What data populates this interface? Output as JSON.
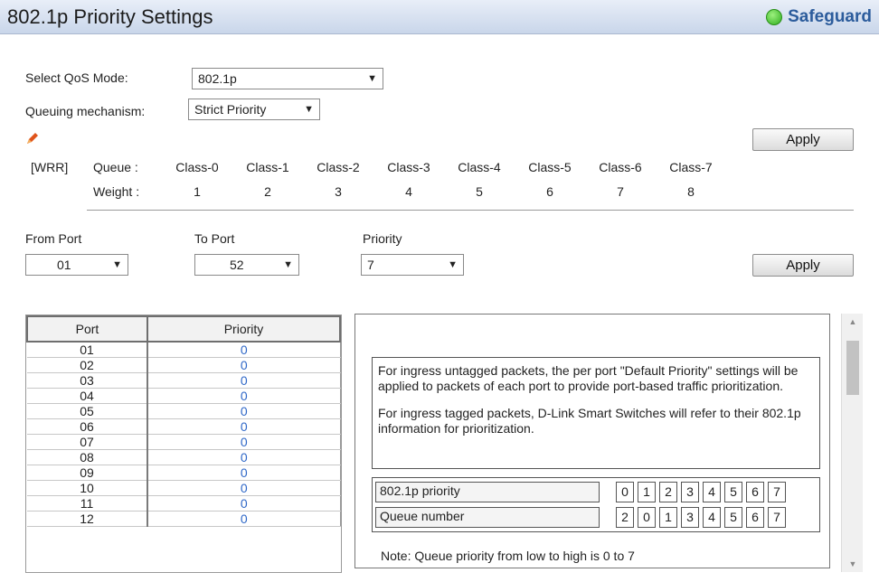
{
  "header": {
    "title": "802.1p Priority Settings",
    "safeguard_label": "Safeguard",
    "safeguard_color": "#2fae1e"
  },
  "qos": {
    "mode_label": "Select QoS Mode:",
    "mode_value": "802.1p",
    "queuing_label": "Queuing mechanism:",
    "queuing_value": "Strict Priority",
    "apply_label": "Apply"
  },
  "wrr": {
    "tag": "[WRR]",
    "queue_label": "Queue :",
    "weight_label": "Weight  :",
    "classes": [
      "Class-0",
      "Class-1",
      "Class-2",
      "Class-3",
      "Class-4",
      "Class-5",
      "Class-6",
      "Class-7"
    ],
    "weights": [
      "1",
      "2",
      "3",
      "4",
      "5",
      "6",
      "7",
      "8"
    ]
  },
  "port_form": {
    "from_label": "From Port",
    "from_value": "01",
    "to_label": "To Port",
    "to_value": "52",
    "priority_label": "Priority",
    "priority_value": "7",
    "apply_label": "Apply"
  },
  "port_table": {
    "headers": [
      "Port",
      "Priority"
    ],
    "rows": [
      {
        "port": "01",
        "priority": "0"
      },
      {
        "port": "02",
        "priority": "0"
      },
      {
        "port": "03",
        "priority": "0"
      },
      {
        "port": "04",
        "priority": "0"
      },
      {
        "port": "05",
        "priority": "0"
      },
      {
        "port": "06",
        "priority": "0"
      },
      {
        "port": "07",
        "priority": "0"
      },
      {
        "port": "08",
        "priority": "0"
      },
      {
        "port": "09",
        "priority": "0"
      },
      {
        "port": "10",
        "priority": "0"
      },
      {
        "port": "11",
        "priority": "0"
      },
      {
        "port": "12",
        "priority": "0"
      }
    ]
  },
  "notes": {
    "para1": "For ingress untagged packets, the per port \"Default Priority\" settings will be applied to packets of each port to provide port-based traffic prioritization.",
    "para2": "For ingress tagged packets, D-Link Smart Switches will refer to their 802.1p information for prioritization.",
    "map_priority_label": "802.1p priority",
    "map_priority_values": [
      "0",
      "1",
      "2",
      "3",
      "4",
      "5",
      "6",
      "7"
    ],
    "map_queue_label": "Queue number",
    "map_queue_values": [
      "2",
      "0",
      "1",
      "3",
      "4",
      "5",
      "6",
      "7"
    ],
    "footer": "Note: Queue priority from low to high is 0 to 7"
  }
}
